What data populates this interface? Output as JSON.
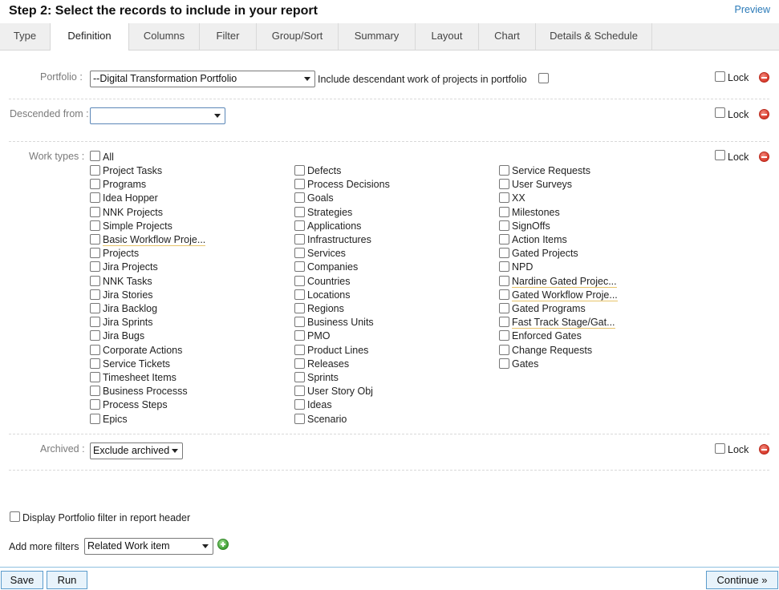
{
  "header": {
    "title": "Step 2: Select the records to include in your report",
    "preview": "Preview"
  },
  "tabs": [
    {
      "label": "Type"
    },
    {
      "label": "Definition"
    },
    {
      "label": "Columns"
    },
    {
      "label": "Filter"
    },
    {
      "label": "Group/Sort"
    },
    {
      "label": "Summary"
    },
    {
      "label": "Layout"
    },
    {
      "label": "Chart"
    },
    {
      "label": "Details & Schedule"
    }
  ],
  "active_tab": "Definition",
  "portfolio": {
    "label": "Portfolio :",
    "value": "--Digital Transformation Portfolio",
    "descendant_label": "Include descendant work of projects in portfolio",
    "lock": "Lock"
  },
  "descended_from": {
    "label": "Descended from :",
    "value": "",
    "lock": "Lock"
  },
  "work_types": {
    "label": "Work types :",
    "all": "All",
    "lock": "Lock",
    "col1": [
      "Project Tasks",
      "Programs",
      "Idea Hopper",
      "NNK Projects",
      "Simple Projects",
      "Basic Workflow Proje...",
      "Projects",
      "Jira Projects",
      "NNK Tasks",
      "Jira Stories",
      "Jira Backlog",
      "Jira Sprints",
      "Jira Bugs",
      "Corporate Actions",
      "Service Tickets",
      "Timesheet Items",
      "Business Processs",
      "Process Steps",
      "Epics"
    ],
    "col2": [
      "Defects",
      "Process Decisions",
      "Goals",
      "Strategies",
      "Applications",
      "Infrastructures",
      "Services",
      "Companies",
      "Countries",
      "Locations",
      "Regions",
      "Business Units",
      "PMO",
      "Product Lines",
      "Releases",
      "Sprints",
      "User Story Obj",
      "Ideas",
      "Scenario"
    ],
    "col3": [
      "Service Requests",
      "User Surveys",
      "XX",
      "Milestones",
      "SignOffs",
      "Action Items",
      "Gated Projects",
      "NPD",
      "Nardine Gated Projec...",
      "Gated Workflow Proje...",
      "Gated Programs",
      "Fast Track Stage/Gat...",
      "Enforced Gates",
      "Change Requests",
      "Gates"
    ]
  },
  "archived": {
    "label": "Archived :",
    "value": "Exclude archived",
    "lock": "Lock"
  },
  "display_portfolio_filter": "Display Portfolio filter in report header",
  "add_more_filters": {
    "label": "Add more filters",
    "value": "Related Work item"
  },
  "footer": {
    "save": "Save",
    "run": "Run",
    "continue": "Continue »"
  }
}
